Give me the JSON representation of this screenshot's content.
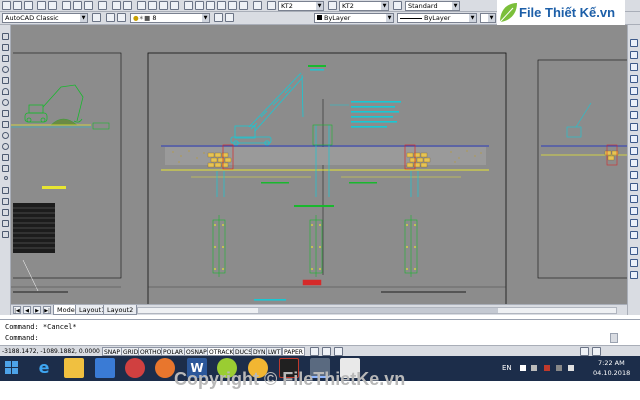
{
  "toolbar": {
    "workspace": "AutoCAD Classic",
    "layer_value": "8",
    "color_value": "ByLayer",
    "linetype_value": "ByLayer",
    "dim_style": "KT2",
    "text_style": "KT2",
    "table_style": "Standard"
  },
  "tabs": {
    "model": "Model",
    "layout1": "Layout1",
    "layout2": "Layout2"
  },
  "command": {
    "line1": "Command: *Cancel*",
    "line2": "Command:"
  },
  "status": {
    "coords": "-3188.1472, -1089.1882, 0.0000",
    "buttons": [
      "SNAP",
      "GRID",
      "ORTHO",
      "POLAR",
      "OSNAP",
      "OTRACK",
      "DUCS",
      "DYN",
      "LWT",
      "PAPER"
    ]
  },
  "taskbar": {
    "lang": "EN",
    "time": "7:22 AM",
    "date": "04.10.2018"
  },
  "brand": {
    "logo": "File Thiết Kế.vn"
  },
  "watermark": {
    "text": "Copyright © FileThietKe.vn"
  },
  "colors": {
    "canvas": "#8c8c8c",
    "paper_border": "#111111",
    "drawing_green": "#19b82e",
    "drawing_cyan": "#18c8d4",
    "drawing_yellow": "#e8e632",
    "taskbar": "#1c2d4a",
    "watermark": "#b8b8b8"
  }
}
